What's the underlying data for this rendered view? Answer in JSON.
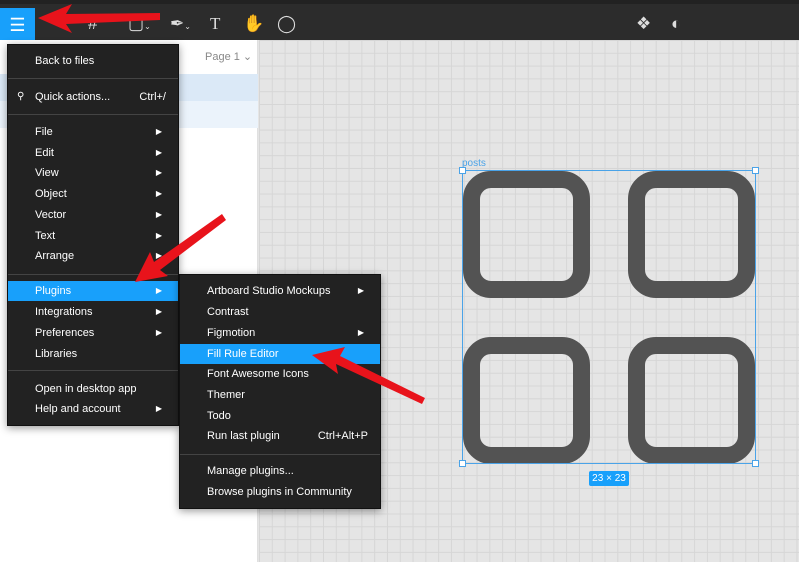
{
  "toolbar": {
    "menu_icon": "hamburger-icon",
    "tools": [
      "frame-icon",
      "shape-icon",
      "pen-icon",
      "text-icon",
      "hand-icon",
      "comment-icon"
    ],
    "right": [
      "components-icon",
      "contrast-icon"
    ]
  },
  "left_panel": {
    "page": "Page 1"
  },
  "main_menu": {
    "items": [
      {
        "label": "Back to files"
      },
      {
        "label": "Quick actions...",
        "shortcut": "Ctrl+/"
      },
      {
        "label": "File"
      },
      {
        "label": "Edit"
      },
      {
        "label": "View"
      },
      {
        "label": "Object"
      },
      {
        "label": "Vector"
      },
      {
        "label": "Text"
      },
      {
        "label": "Arrange"
      },
      {
        "label": "Plugins"
      },
      {
        "label": "Integrations"
      },
      {
        "label": "Preferences"
      },
      {
        "label": "Libraries"
      },
      {
        "label": "Open in desktop app"
      },
      {
        "label": "Help and account"
      }
    ]
  },
  "plugins_menu": {
    "items": [
      {
        "label": "Artboard Studio Mockups"
      },
      {
        "label": "Contrast"
      },
      {
        "label": "Figmotion"
      },
      {
        "label": "Fill Rule Editor"
      },
      {
        "label": "Font Awesome Icons"
      },
      {
        "label": "Themer"
      },
      {
        "label": "Todo"
      },
      {
        "label": "Run last plugin",
        "shortcut": "Ctrl+Alt+P"
      },
      {
        "label": "Manage plugins..."
      },
      {
        "label": "Browse plugins in Community"
      }
    ]
  },
  "canvas": {
    "frame_name": "posts",
    "size": "23 × 23"
  },
  "colors": {
    "accent": "#18a0fb",
    "arrow": "#e8131b"
  }
}
